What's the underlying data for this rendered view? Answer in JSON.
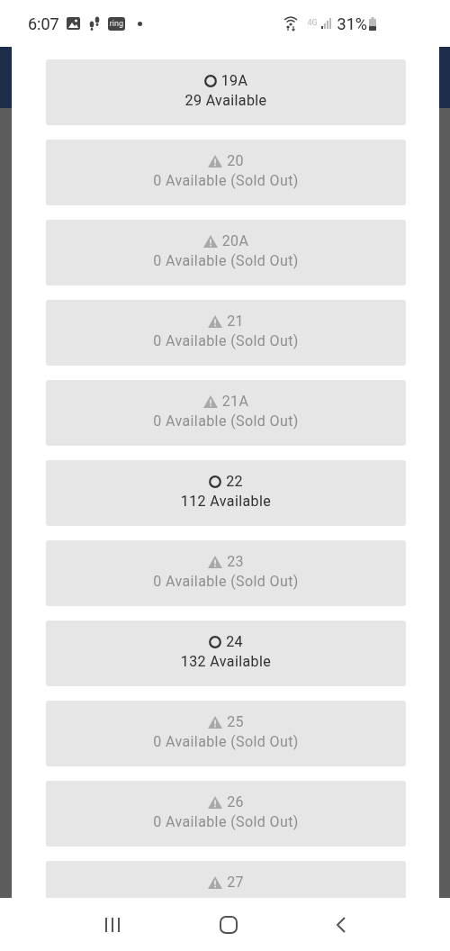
{
  "status_bar": {
    "time": "6:07",
    "app_badge": "ring",
    "network": "4G",
    "battery": "31%"
  },
  "options": [
    {
      "name": "19A",
      "status": "29 Available",
      "disabled": false
    },
    {
      "name": "20",
      "status": "0 Available (Sold Out)",
      "disabled": true
    },
    {
      "name": "20A",
      "status": "0 Available (Sold Out)",
      "disabled": true
    },
    {
      "name": "21",
      "status": "0 Available (Sold Out)",
      "disabled": true
    },
    {
      "name": "21A",
      "status": "0 Available (Sold Out)",
      "disabled": true
    },
    {
      "name": "22",
      "status": "112 Available",
      "disabled": false
    },
    {
      "name": "23",
      "status": "0 Available (Sold Out)",
      "disabled": true
    },
    {
      "name": "24",
      "status": "132 Available",
      "disabled": false
    },
    {
      "name": "25",
      "status": "0 Available (Sold Out)",
      "disabled": true
    },
    {
      "name": "26",
      "status": "0 Available (Sold Out)",
      "disabled": true
    },
    {
      "name": "27",
      "disabled": true
    }
  ]
}
